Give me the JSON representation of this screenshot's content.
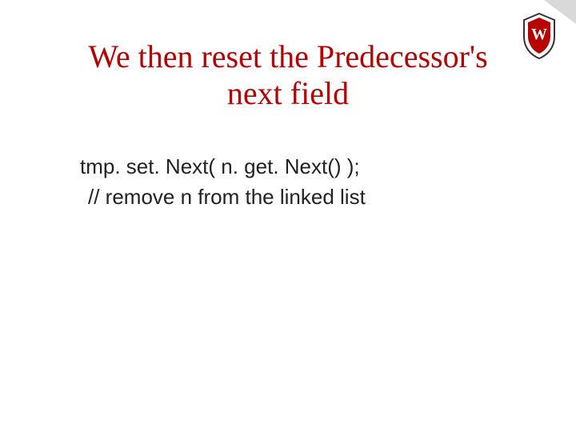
{
  "title_line1": "We then reset the Predecessor's",
  "title_line2": "next field",
  "code_line1": "tmp. set. Next( n. get. Next() );",
  "code_line2": "// remove n from the linked list",
  "logo_letter": "W",
  "colors": {
    "title": "#b70101",
    "logo_border": "#333333",
    "logo_fill": "#b70101"
  }
}
